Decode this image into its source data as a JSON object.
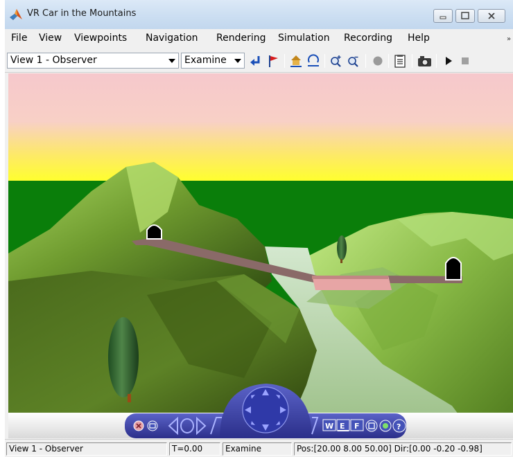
{
  "window": {
    "title": "VR Car in the Mountains"
  },
  "menu": {
    "items": [
      "File",
      "View",
      "Viewpoints",
      "Navigation",
      "Rendering",
      "Simulation",
      "Recording",
      "Help"
    ],
    "overflow": "»"
  },
  "toolbar": {
    "viewpoint_value": "View 1 - Observer",
    "navigation_mode_value": "Examine",
    "icons": [
      "return-to-viewpoint-icon",
      "create-viewpoint-icon",
      "go-to-home-icon",
      "straighten-up-icon",
      "zoom-in-icon",
      "zoom-out-icon",
      "record-icon",
      "preferences-icon",
      "capture-frame-icon",
      "play-icon",
      "stop-icon"
    ]
  },
  "scene": {
    "sky_colors": [
      "#f6c8cc",
      "#ffff2f"
    ],
    "ground_color": "#0a7e0a",
    "navigation_panel": {
      "button_labels": {
        "walk": "W",
        "examine": "E",
        "fly": "F",
        "help": "?"
      },
      "icons": [
        "close-icon",
        "minimize-icon",
        "rotate-left-icon",
        "rotate-right-icon",
        "compass-dial-icon",
        "straighten-icon",
        "headlight-icon"
      ]
    }
  },
  "status": {
    "viewpoint": "View 1 - Observer",
    "time": "T=0.00",
    "mode": "Examine",
    "pose": "Pos:[20.00 8.00 50.00] Dir:[0.00 -0.20 -0.98]"
  }
}
